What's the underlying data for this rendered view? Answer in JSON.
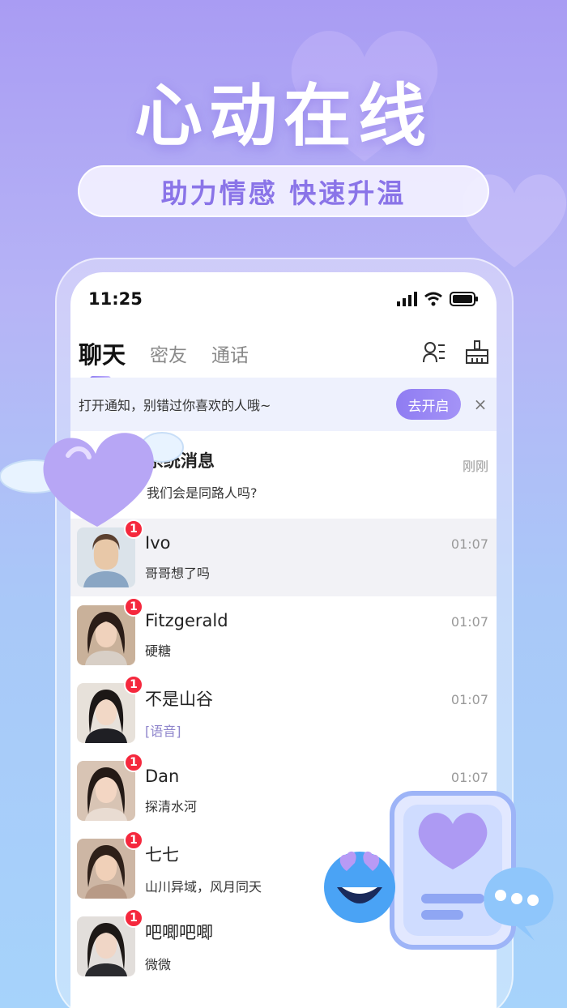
{
  "promo": {
    "headline": "心动在线",
    "tagline": "助力情感  快速升温"
  },
  "status_bar": {
    "time": "11:25",
    "icons": [
      "signal-icon",
      "wifi-icon",
      "battery-icon"
    ]
  },
  "tabs": [
    {
      "label": "聊天",
      "active": true
    },
    {
      "label": "密友",
      "active": false
    },
    {
      "label": "通话",
      "active": false
    }
  ],
  "tab_tools": [
    "contacts-icon",
    "broom-icon"
  ],
  "notice": {
    "text": "打开通知，别错过你喜欢的人哦~",
    "button": "去开启",
    "close": "×"
  },
  "system_message": {
    "title": "系统消息",
    "message": "我们会是同路人吗?",
    "time": "刚刚"
  },
  "chats": [
    {
      "name": "Ivo",
      "message": "哥哥想了吗",
      "time": "01:07",
      "unread": "1"
    },
    {
      "name": "Fitzgerald",
      "message": "硬糖",
      "time": "01:07",
      "unread": "1"
    },
    {
      "name": "不是山谷",
      "message": "[语音]",
      "time": "01:07",
      "unread": "1"
    },
    {
      "name": "Dan",
      "message": "探清水河",
      "time": "01:07",
      "unread": "1"
    },
    {
      "name": "七七",
      "message": "山川异域，风月同天",
      "time": "",
      "unread": "1"
    },
    {
      "name": "吧唧吧唧",
      "message": "微微",
      "time": "",
      "unread": "1"
    }
  ],
  "colors": {
    "accent": "#8f7cf2",
    "badge": "#f5283d",
    "highlight_row": "#f2f2f6"
  }
}
